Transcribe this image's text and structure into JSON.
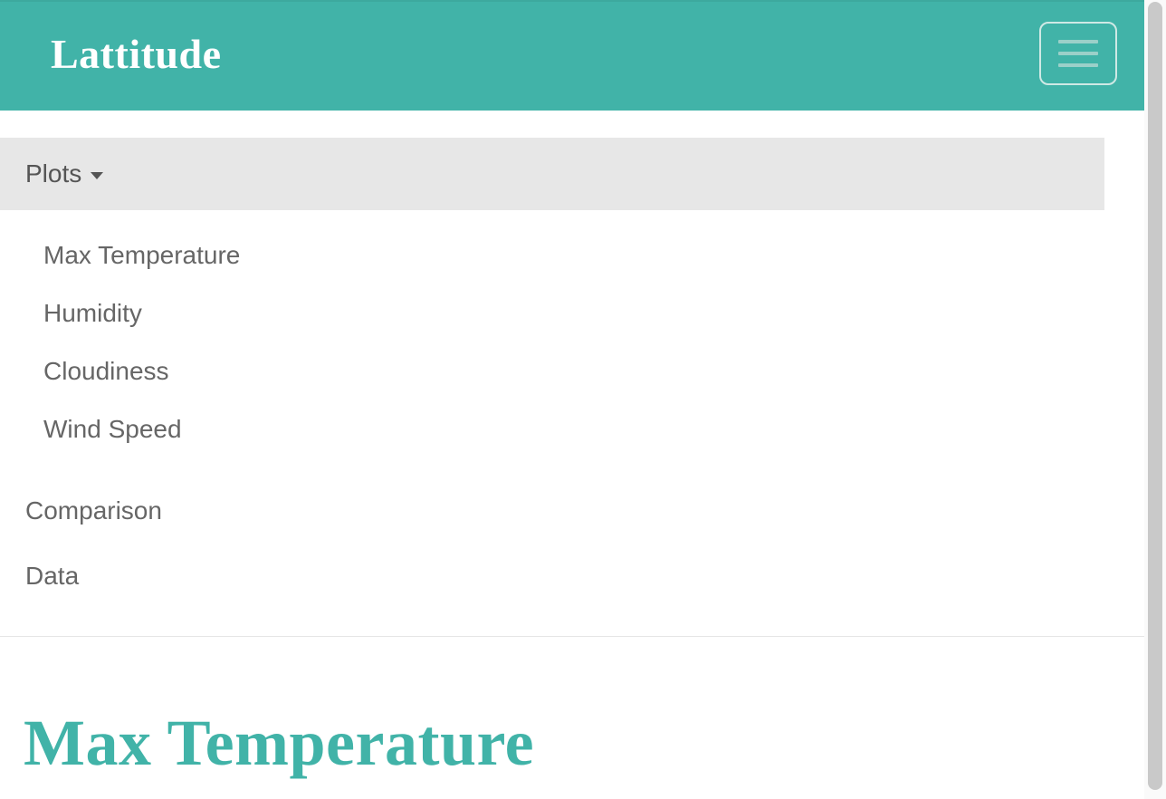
{
  "navbar": {
    "brand": "Lattitude"
  },
  "subnav": {
    "plots_label": "Plots",
    "plot_items": [
      "Max Temperature",
      "Humidity",
      "Cloudiness",
      "Wind Speed"
    ],
    "top_items": [
      "Comparison",
      "Data"
    ]
  },
  "page": {
    "title": "Max Temperature"
  },
  "colors": {
    "accent": "#41b3a8",
    "subnav_bg": "#e7e7e7",
    "text_muted": "#666"
  }
}
